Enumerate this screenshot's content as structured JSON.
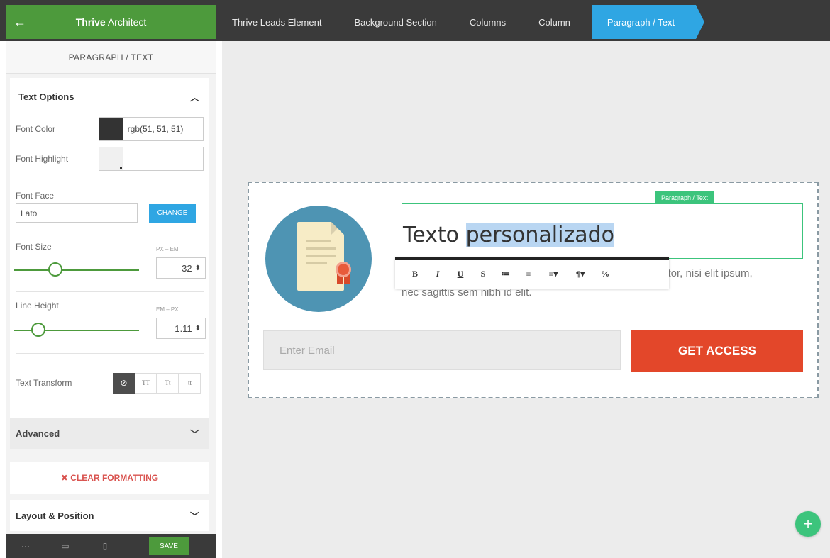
{
  "brand": {
    "back_icon": "arrow-left-icon",
    "name_bold": "Thrive",
    "name_rest": " Architect"
  },
  "breadcrumbs": [
    {
      "label": "Thrive Leads Element"
    },
    {
      "label": "Background Section"
    },
    {
      "label": "Columns"
    },
    {
      "label": "Column"
    },
    {
      "label": "Paragraph / Text"
    }
  ],
  "sidebar": {
    "title": "PARAGRAPH / TEXT",
    "text_options": {
      "heading": "Text Options",
      "font_color_label": "Font Color",
      "font_color_value": "rgb(51, 51, 51)",
      "font_highlight_label": "Font Highlight",
      "font_face_label": "Font Face",
      "font_face_value": "Lato",
      "change_label": "CHANGE",
      "font_size_label": "Font Size",
      "font_size_unit": "PX – EM",
      "font_size_value": "32",
      "line_height_label": "Line Height",
      "line_height_unit": "EM – PX",
      "line_height_value": "1.11",
      "text_transform_label": "Text Transform",
      "transform_options": [
        "⊘",
        "TT",
        "Tt",
        "tt"
      ]
    },
    "advanced_label": "Advanced",
    "clear_label": "✖ CLEAR FORMATTING",
    "layout_label": "Layout & Position",
    "save_label": "SAVE"
  },
  "canvas": {
    "tag_label": "Paragraph / Text",
    "headline_plain": "Texto ",
    "headline_selected": "personalizado",
    "body_visible_right": "ctor, nisi elit ipsum,",
    "body_line2": "nec sagittis sem nibh id elit.",
    "email_placeholder": "Enter Email",
    "cta_label": "GET ACCESS",
    "toolbar_buttons": [
      "B",
      "I",
      "U",
      "S",
      "≔",
      "≡",
      "≡▾",
      "¶▾",
      "%"
    ]
  },
  "colors": {
    "accent_green": "#4d9a3c",
    "accent_blue": "#2fa6e3",
    "cta_red": "#e3472a",
    "font_color": "#333333"
  }
}
